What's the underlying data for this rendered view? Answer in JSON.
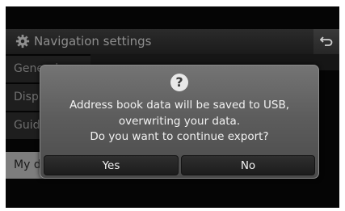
{
  "header": {
    "title": "Navigation settings",
    "settings_icon": "gear-icon",
    "back_icon": "back-arrow-icon"
  },
  "sidebar": {
    "items": [
      {
        "label": "General",
        "active": false
      },
      {
        "label": "Display",
        "active": false
      },
      {
        "label": "Guidance",
        "active": false
      },
      {
        "label": "My data",
        "active": true
      }
    ]
  },
  "dialog": {
    "icon": "question-icon",
    "icon_glyph": "?",
    "message_lines": [
      "Address book data will be saved to USB,",
      "overwriting your data.",
      "Do you want to continue export?"
    ],
    "yes_label": "Yes",
    "no_label": "No"
  }
}
